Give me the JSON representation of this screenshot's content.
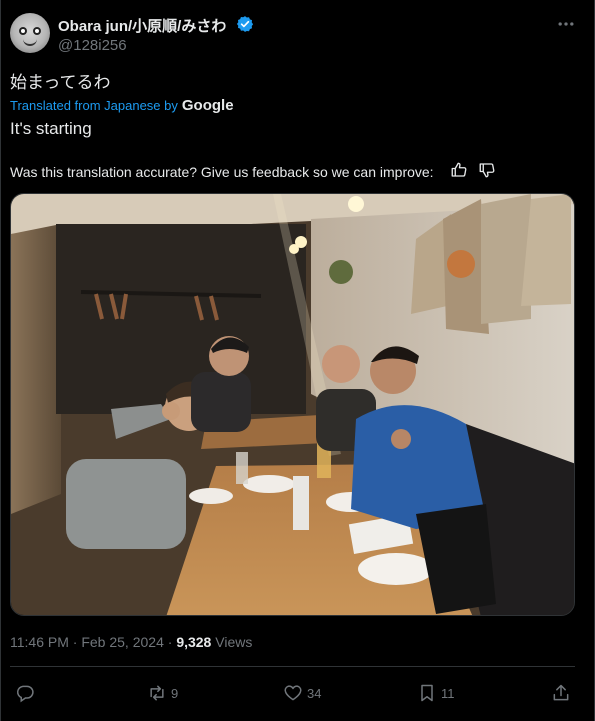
{
  "post": {
    "author": {
      "display_name": "Obara jun/小原順/みさわ",
      "handle": "@128i256",
      "verified": true
    },
    "text": "始まってるわ",
    "translated_from": "Translated from Japanese by",
    "translator": "Google",
    "translation": "It's starting",
    "feedback_prompt": "Was this translation accurate? Give us feedback so we can improve:",
    "time": "11:46 PM",
    "separator": "·",
    "date": "Feb 25, 2024",
    "views_count": "9,328",
    "views_label": "Views"
  },
  "actions": {
    "reply_count": "",
    "repost_count": "9",
    "like_count": "34",
    "bookmark_count": "11"
  },
  "icons": [
    "more-icon",
    "verified-badge-icon",
    "thumbs-up-icon",
    "thumbs-down-icon",
    "reply-icon",
    "repost-icon",
    "like-icon",
    "bookmark-icon",
    "share-icon"
  ],
  "colors": {
    "background": "#000000",
    "text": "#e7e9ea",
    "muted": "#71767b",
    "accent": "#1d9bf0",
    "border": "#2f3336"
  }
}
